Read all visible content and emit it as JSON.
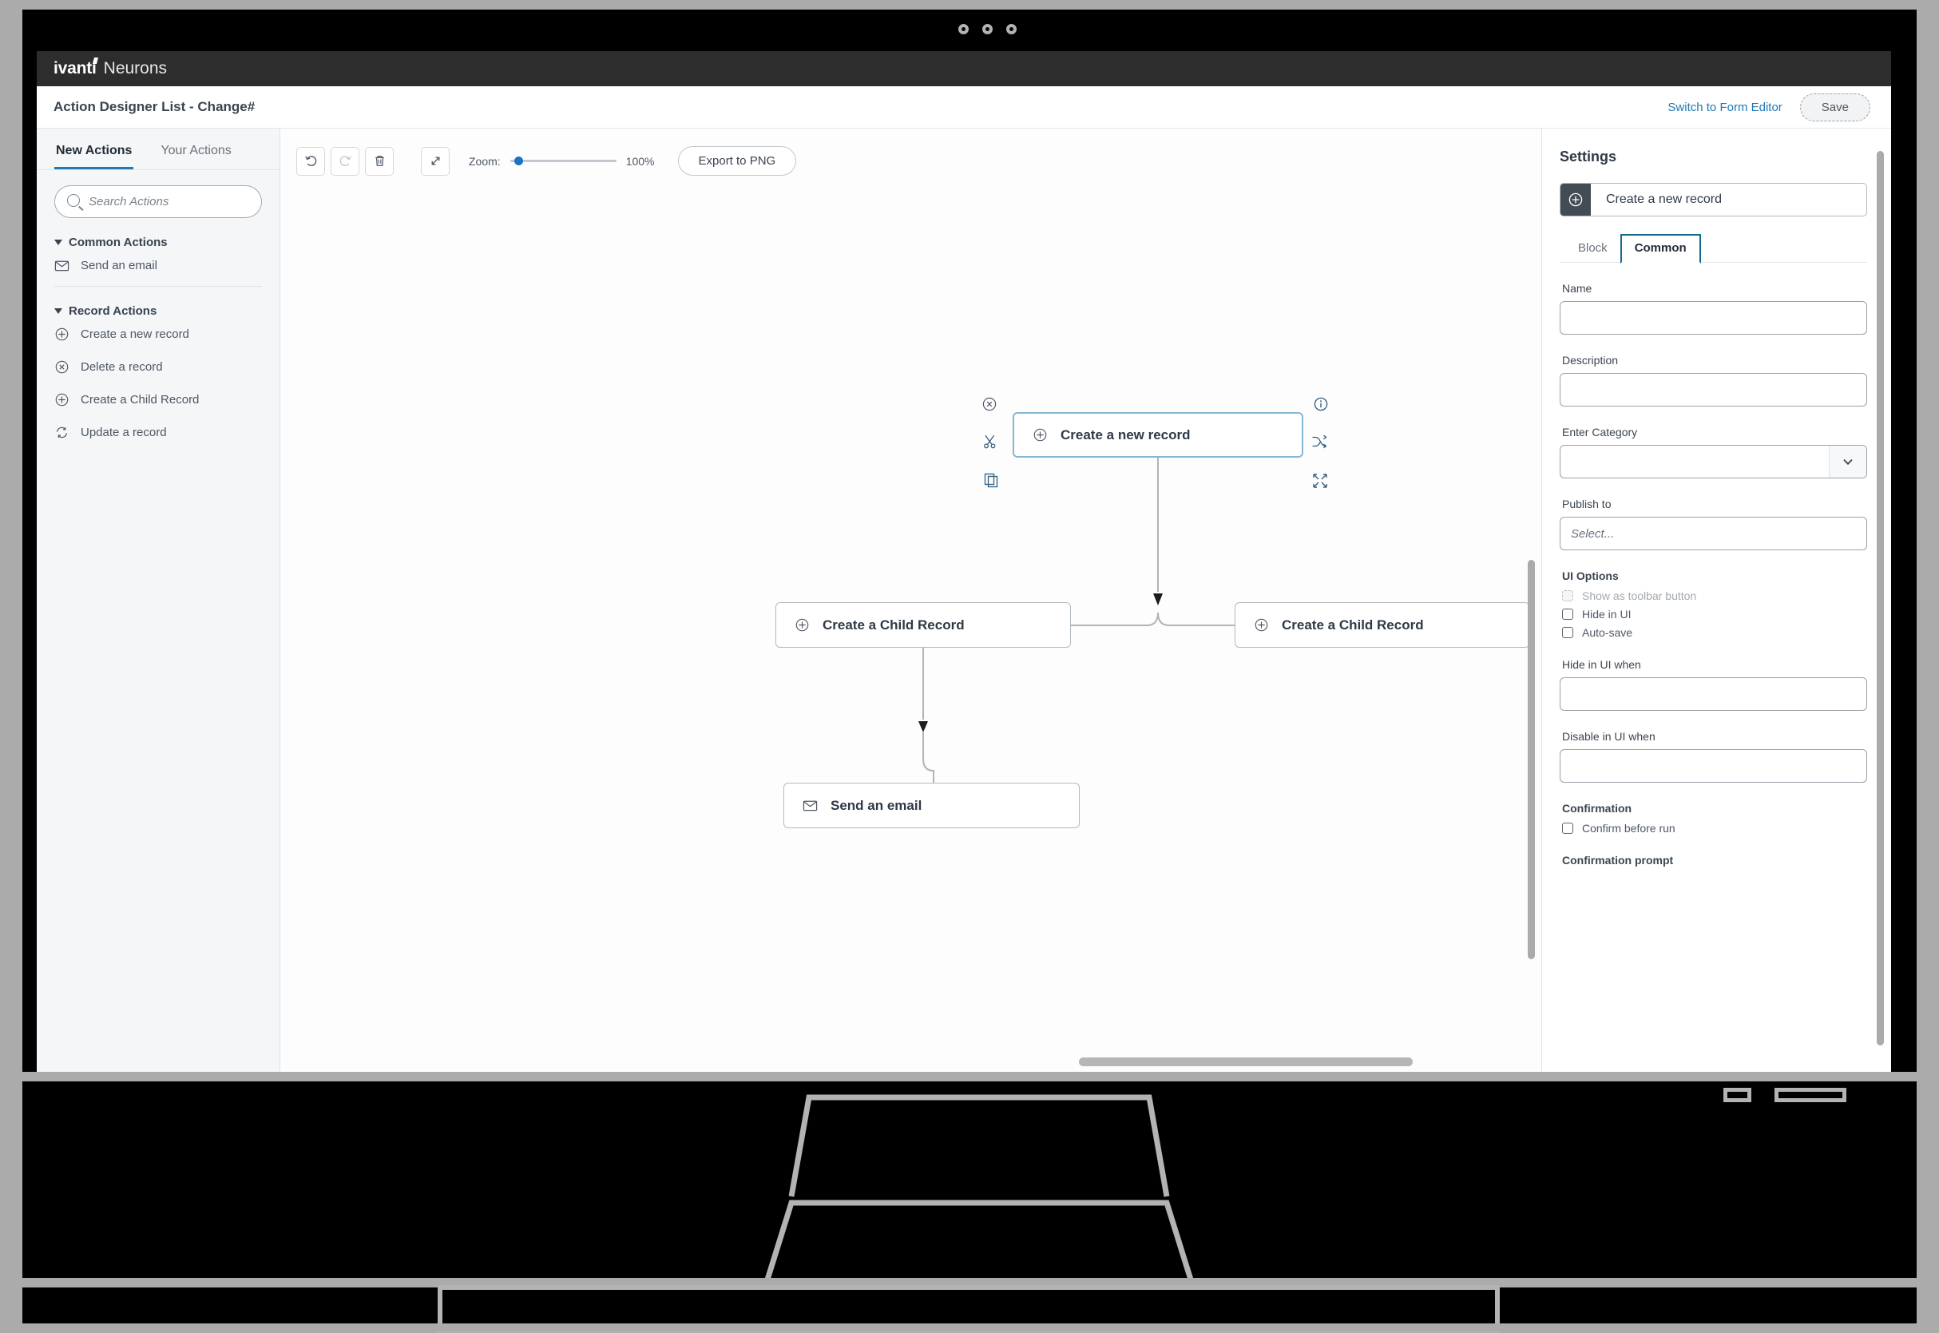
{
  "brand": {
    "name": "ivanti",
    "product": "Neurons"
  },
  "header": {
    "title": "Action Designer List - Change#",
    "switch_link": "Switch to Form Editor",
    "save_label": "Save"
  },
  "left_panel": {
    "tabs": [
      {
        "label": "New Actions",
        "active": true
      },
      {
        "label": "Your Actions",
        "active": false
      }
    ],
    "search": {
      "placeholder": "Search Actions",
      "value": ""
    },
    "groups": [
      {
        "title": "Common Actions",
        "items": [
          {
            "label": "Send an email",
            "icon": "envelope-icon"
          }
        ]
      },
      {
        "title": "Record Actions",
        "items": [
          {
            "label": "Create a new record",
            "icon": "plus-circle-icon"
          },
          {
            "label": "Delete a record",
            "icon": "x-circle-icon"
          },
          {
            "label": "Create a Child Record",
            "icon": "plus-circle-icon"
          },
          {
            "label": "Update a record",
            "icon": "refresh-icon"
          }
        ]
      }
    ]
  },
  "toolbar": {
    "undo_icon": "undo-icon",
    "redo_icon": "redo-icon",
    "delete_icon": "trash-icon",
    "fit_icon": "fit-to-screen-icon",
    "zoom_label": "Zoom:",
    "zoom_value": "100%",
    "zoom_percent": 100,
    "export_label": "Export to PNG"
  },
  "canvas": {
    "nodes": [
      {
        "id": "root",
        "label": "Create a new record",
        "icon": "plus-circle-icon",
        "selected": true
      },
      {
        "id": "child-left",
        "label": "Create a Child Record",
        "icon": "plus-circle-icon",
        "selected": false
      },
      {
        "id": "child-right",
        "label": "Create a Child Record",
        "icon": "plus-circle-icon",
        "selected": false
      },
      {
        "id": "email",
        "label": "Send an email",
        "icon": "envelope-icon",
        "selected": false
      }
    ],
    "handles": [
      {
        "name": "delete-node-handle",
        "icon": "x-circle-icon"
      },
      {
        "name": "info-handle",
        "icon": "info-circle-icon"
      },
      {
        "name": "cut-handle",
        "icon": "scissors-icon"
      },
      {
        "name": "disconnect-handle",
        "icon": "shuffle-icon"
      },
      {
        "name": "copy-handle",
        "icon": "copy-icon"
      },
      {
        "name": "expand-handle",
        "icon": "expand-icon"
      }
    ]
  },
  "settings": {
    "title": "Settings",
    "node_name": "Create a new record",
    "node_icon": "plus-circle-icon",
    "tabs": [
      {
        "label": "Block",
        "active": false
      },
      {
        "label": "Common",
        "active": true
      }
    ],
    "fields": [
      {
        "label": "Name",
        "value": "",
        "placeholder": ""
      },
      {
        "label": "Description",
        "value": "",
        "placeholder": ""
      }
    ],
    "category": {
      "label": "Enter Category",
      "value": "",
      "chevron": "chevron-down-icon"
    },
    "publish_to": {
      "label": "Publish to",
      "value": "",
      "placeholder": "Select..."
    },
    "ui_options": {
      "label": "UI Options",
      "items": [
        {
          "label": "Show as toolbar button",
          "checked": false,
          "disabled": true
        },
        {
          "label": "Hide in UI",
          "checked": false,
          "disabled": false
        },
        {
          "label": "Auto-save",
          "checked": false,
          "disabled": false
        }
      ]
    },
    "hide_when": {
      "label": "Hide in UI when",
      "value": ""
    },
    "disable_when": {
      "label": "Disable in UI when",
      "value": ""
    },
    "confirmation": {
      "label": "Confirmation",
      "checkbox": {
        "label": "Confirm before run",
        "checked": false
      },
      "prompt_label": "Confirmation prompt"
    }
  },
  "colors": {
    "accent": "#2178b5",
    "tab_border": "#15688f",
    "selected_node": "#86b6d4",
    "brandbar": "#2d2d2d"
  }
}
